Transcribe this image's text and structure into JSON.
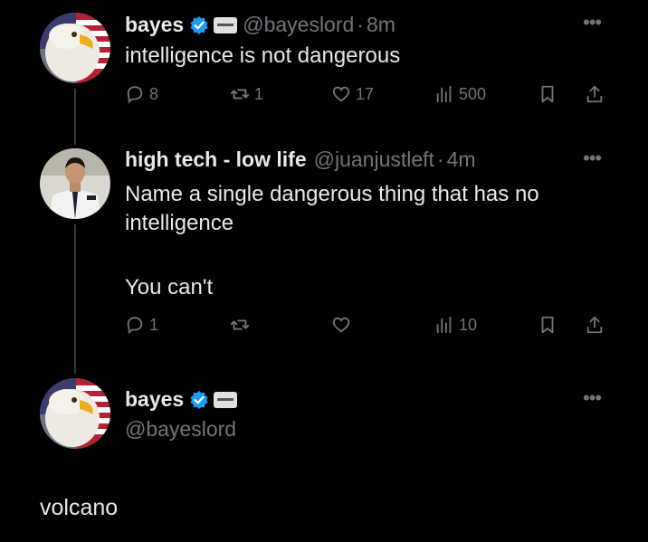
{
  "tweets": [
    {
      "display_name": "bayes",
      "handle": "@bayeslord",
      "separator": "·",
      "time": "8m",
      "text": "intelligence is not dangerous",
      "replies": "8",
      "reposts": "1",
      "likes": "17",
      "views": "500"
    },
    {
      "display_name": "high tech - low life",
      "handle": "@juanjustleft",
      "separator": "·",
      "time": "4m",
      "text_line1": "Name a single dangerous thing that has no",
      "text_line2": "intelligence",
      "text_line3": "You can't",
      "replies": "1",
      "reposts": "",
      "likes": "",
      "views": "10"
    },
    {
      "display_name": "bayes",
      "handle": "@bayeslord",
      "text": "volcano"
    }
  ],
  "colors": {
    "background": "#000000",
    "text": "#e7e9ea",
    "muted": "#71767b",
    "verified": "#1d9bf0"
  },
  "icons": [
    "reply-icon",
    "repost-icon",
    "like-icon",
    "views-icon",
    "bookmark-icon",
    "share-icon",
    "verified-icon",
    "more-icon"
  ]
}
